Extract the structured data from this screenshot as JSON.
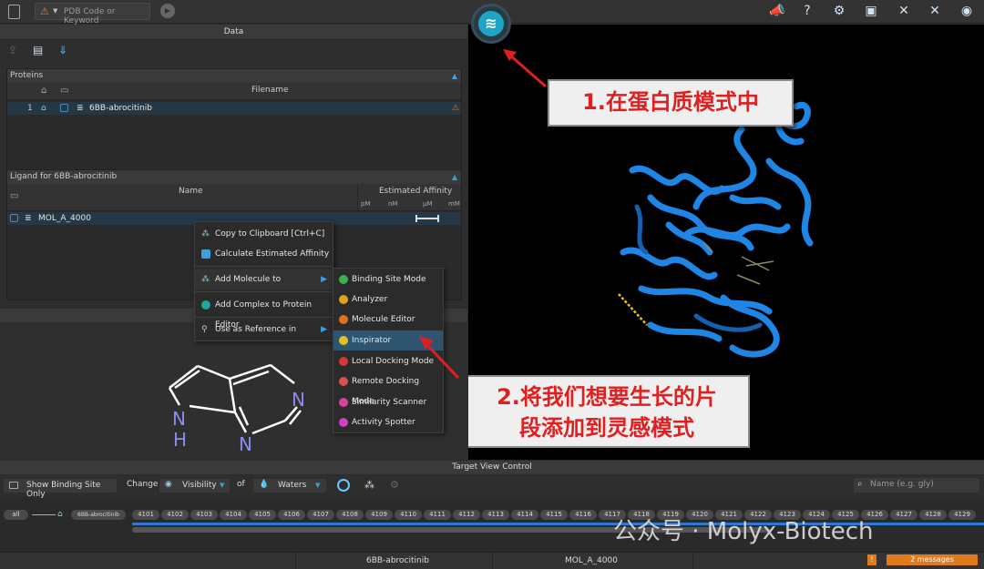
{
  "toolbar": {
    "search_placeholder": "PDB Code or Keyword"
  },
  "data_panel": {
    "title": "Data",
    "proteins": {
      "title": "Proteins",
      "col_filename": "Filename",
      "rows": [
        {
          "index": "1",
          "filename": "6BB-abrocitinib"
        }
      ]
    },
    "ligand": {
      "title": "Ligand for 6BB-abrocitinib",
      "col_name": "Name",
      "col_affinity": "Estimated Affinity",
      "units": [
        "pM",
        "nM",
        "µM",
        "mM"
      ],
      "rows": [
        {
          "name": "MOL_A_4000"
        }
      ]
    }
  },
  "context_menu": {
    "items": [
      "Copy to Clipboard [Ctrl+C]",
      "Calculate Estimated Affinity",
      "Add Molecule to",
      "Add Complex to Protein Editor",
      "Use as Reference in"
    ]
  },
  "submenu": {
    "items": [
      {
        "label": "Binding Site Mode",
        "color": "#3cb04a"
      },
      {
        "label": "Analyzer",
        "color": "#e0a020"
      },
      {
        "label": "Molecule Editor",
        "color": "#e07020"
      },
      {
        "label": "Inspirator",
        "color": "#e8c020"
      },
      {
        "label": "Local Docking Mode",
        "color": "#d83838"
      },
      {
        "label": "Remote Docking Mode",
        "color": "#d85050"
      },
      {
        "label": "Similarity Scanner",
        "color": "#d840a0"
      },
      {
        "label": "Activity Spotter",
        "color": "#d040c0"
      }
    ],
    "highlighted": "Inspirator"
  },
  "structure": {
    "atoms": [
      "N",
      "N",
      "N",
      "H"
    ]
  },
  "callouts": {
    "one": "1.在蛋白质模式中",
    "two_line1": "2.将我们想要生长的片",
    "two_line2": "段添加到灵感模式"
  },
  "target_view": {
    "title": "Target View Control",
    "show_binding_site_only": "Show Binding Site Only",
    "change": "Change",
    "visibility": "Visibility",
    "of": "of",
    "waters": "Waters",
    "name_placeholder": "Name (e.g. gly)",
    "all": "all",
    "chain": "6BB-abrocitinib",
    "residues": [
      "4101",
      "4102",
      "4103",
      "4104",
      "4105",
      "4106",
      "4107",
      "4108",
      "4109",
      "4110",
      "4111",
      "4112",
      "4113",
      "4114",
      "4115",
      "4116",
      "4117",
      "4118",
      "4119",
      "4120",
      "4121",
      "4122",
      "4123",
      "4124",
      "4125",
      "4126",
      "4127",
      "4128",
      "4129"
    ]
  },
  "status": {
    "protein": "6BB-abrocitinib",
    "ligand": "MOL_A_4000",
    "warn": "!",
    "messages": "2 messages"
  },
  "watermark": "公众号 · Molyx-Biotech"
}
